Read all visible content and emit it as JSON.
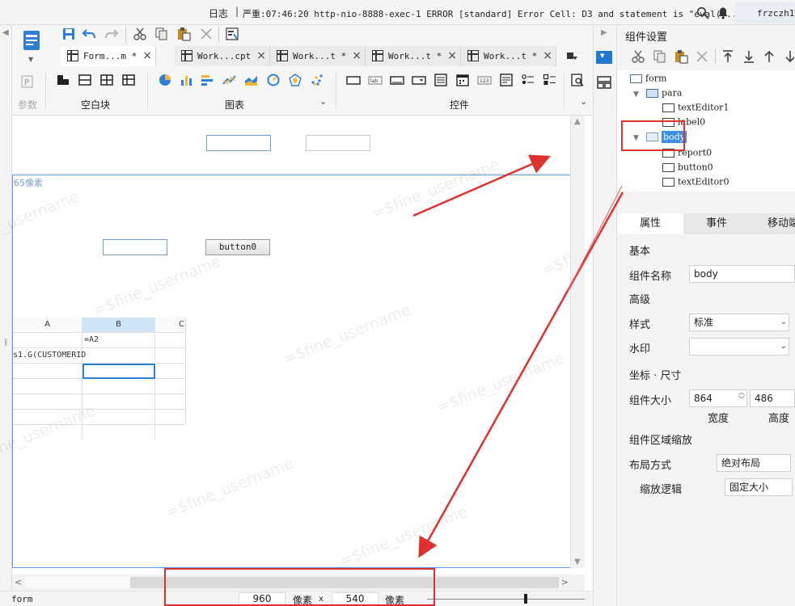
{
  "logbar": {
    "label": "日志",
    "message": "严重:07:46:20 http-nio-8888-exec-1 ERROR [standard] Error Cell: D3 and statement is \"eval(...",
    "user": "frzczh1"
  },
  "tabs": [
    {
      "label": "Form...m *"
    },
    {
      "label": "Work...cpt"
    },
    {
      "label": "Work...t *"
    },
    {
      "label": "Work...t *"
    },
    {
      "label": "Work...t *"
    }
  ],
  "ribbon": {
    "param_label": "参数",
    "blank_label": "空白块",
    "chart_label": "图表",
    "control_label": "控件"
  },
  "canvas": {
    "hint": "65像素",
    "button_label": "button0",
    "watermark": "=$fine_username"
  },
  "grid": {
    "col_a": "A",
    "col_b": "B",
    "col_c": "C",
    "cell_b1": "=A2",
    "cell_a2": "s1.G(CUSTOMERID"
  },
  "status": {
    "file_name": "form",
    "width": "960",
    "height": "540",
    "unit": "像素",
    "times": "x"
  },
  "panel": {
    "title": "组件设置",
    "tree": {
      "form": "form",
      "para": "para",
      "textEditor1": "textEditor1",
      "label0": "label0",
      "body": "body",
      "report0": "report0",
      "button0": "button0",
      "textEditor0": "textEditor0"
    },
    "tabs": {
      "attr": "属性",
      "event": "事件",
      "mobile": "移动端"
    },
    "basic": "基本",
    "name_label": "组件名称",
    "name_value": "body",
    "advanced": "高级",
    "style_label": "样式",
    "style_value": "标准",
    "watermark_label": "水印",
    "coord_section": "坐标 · 尺寸",
    "size_label": "组件大小",
    "width_value": "864",
    "height_value": "486",
    "width_label": "宽度",
    "height_label": "高度",
    "scale_section": "组件区域缩放",
    "layout_label": "布局方式",
    "layout_value": "绝对布局",
    "scale_label": "缩放逻辑",
    "scale_value": "固定大小"
  }
}
